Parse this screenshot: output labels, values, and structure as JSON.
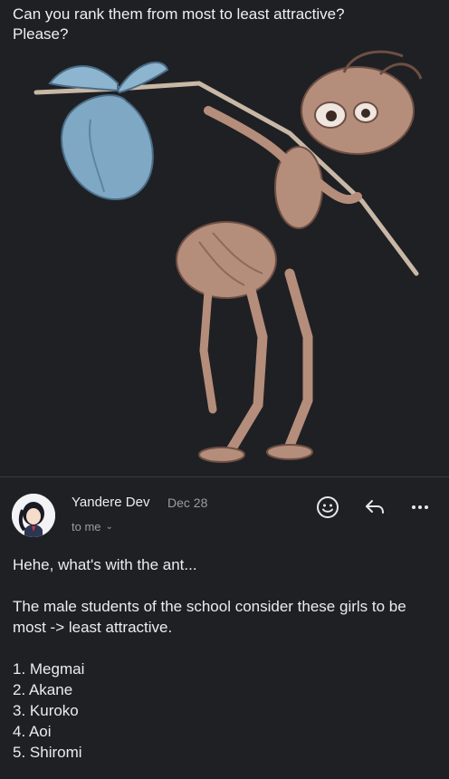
{
  "previous_message": {
    "text": "Can you rank them from most to least attractive?\nPlease?"
  },
  "email": {
    "sender": "Yandere Dev",
    "date": "Dec 28",
    "recipient": "to me",
    "greeting": "Hehe, what's with the ant...",
    "paragraph": "The male students of the school consider these girls to be most -> least attractive.",
    "ranking": [
      "1. Megmai",
      "2. Akane",
      "3. Kuroko",
      "4. Aoi",
      "5. Shiromi"
    ]
  },
  "icons": {
    "emoji": "emoji-icon",
    "reply": "reply-icon",
    "more": "more-icon",
    "recipient_chevron": "chevron-down-icon"
  },
  "colors": {
    "background": "#1f2024",
    "text": "#ececee",
    "muted": "#9b9ca2",
    "bag": "#7fa8c4"
  }
}
